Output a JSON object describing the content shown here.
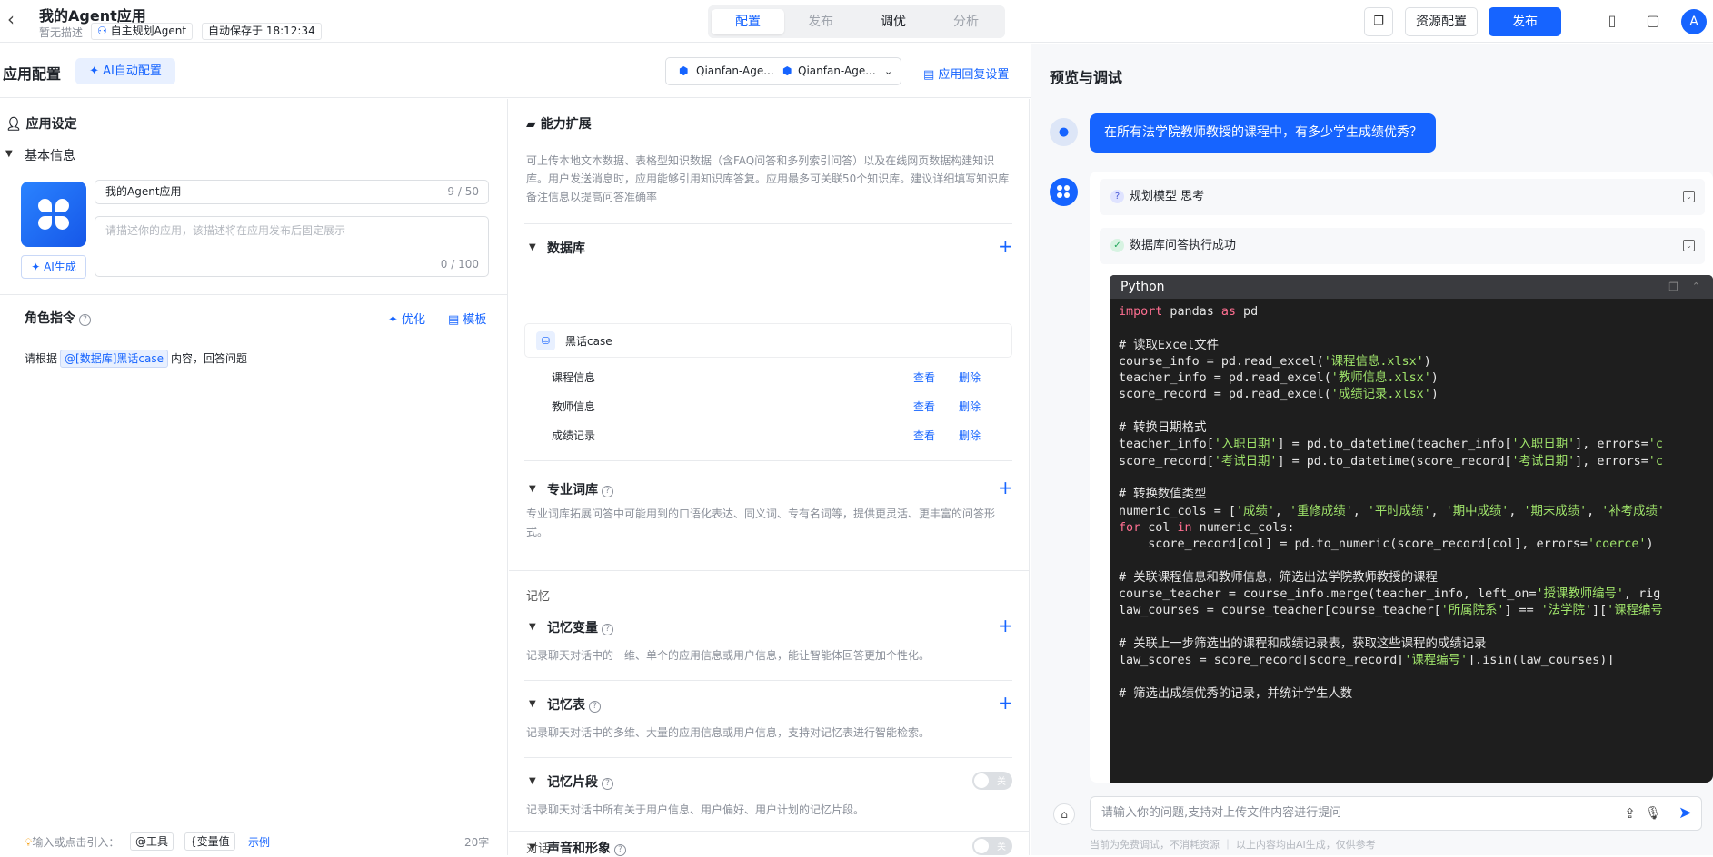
{
  "header": {
    "app_title": "我的Agent应用",
    "no_desc": "暂无描述",
    "agent_type": "自主规划Agent",
    "autosave": "自动保存于 18:12:34",
    "tabs": [
      "配置",
      "发布",
      "调优",
      "分析"
    ],
    "resource_config": "资源配置",
    "publish": "发布",
    "user_initial": "A"
  },
  "config": {
    "title": "应用配置",
    "ai_auto": "AI自动配置",
    "model_a": "Qianfan-Age...",
    "model_b": "Qianfan-Age...",
    "reply_settings": "应用回复设置"
  },
  "app_settings": {
    "title": "应用设定",
    "basic_info": "基本信息",
    "name_value": "我的Agent应用",
    "name_count": "9 / 50",
    "desc_placeholder": "请描述你的应用，该描述将在应用发布后固定展示",
    "desc_count": "0 / 100",
    "ai_gen": "AI生成",
    "role_title": "角色指令",
    "optimize": "优化",
    "template": "模板",
    "instr_prefix": "请根据",
    "instr_mention": "@[数据库]黑话case",
    "instr_suffix": "内容，回答问题",
    "foot_hint": "输入或点击引入：",
    "chip_tool": "@工具",
    "chip_var": "{变量值",
    "example": "示例",
    "char_count": "20字"
  },
  "abilities": {
    "title": "能力扩展",
    "desc": "可上传本地文本数据、表格型知识数据（含FAQ问答和多列索引问答）以及在线网页数据构建知识库。用户发送消息时，应用能够引用知识库答复。应用最多可关联50个知识库。建议详细填写知识库备注信息以提高问答准确率",
    "database": "数据库",
    "db_name": "黑话case",
    "tables": [
      "课程信息",
      "教师信息",
      "成绩记录"
    ],
    "view": "查看",
    "delete": "删除",
    "lexicon": "专业词库",
    "lexicon_desc": "专业词库拓展问答中可能用到的口语化表达、同义词、专有名词等，提供更灵活、更丰富的问答形式。",
    "memory": "记忆",
    "mem_var": "记忆变量",
    "mem_var_desc": "记录聊天对话中的一维、单个的应用信息或用户信息，能让智能体回答更加个性化。",
    "mem_table": "记忆表",
    "mem_table_desc": "记录聊天对话中的多维、大量的应用信息或用户信息，支持对记忆表进行智能检索。",
    "mem_snip": "记忆片段",
    "mem_snip_desc": "记录聊天对话中所有关于用户信息、用户偏好、用户计划的记忆片段。",
    "toggle_off": "关",
    "dialog": "对话",
    "voice": "声音和形象"
  },
  "preview": {
    "title": "预览与调试",
    "question": "在所有法学院教师教授的课程中，有多少学生成绩优秀？",
    "step1": "规划模型 思考",
    "step2": "数据库问答执行成功",
    "code_lang": "Python",
    "input_placeholder": "请输入你的问题,支持对上传文件内容进行提问",
    "disclaimer": "当前为免费调试，不消耗资源  ｜  以上内容均由AI生成，仅供参考"
  },
  "code_lines": [
    "import pandas as pd",
    "",
    "# 读取Excel文件",
    "course_info = pd.read_excel('课程信息.xlsx')",
    "teacher_info = pd.read_excel('教师信息.xlsx')",
    "score_record = pd.read_excel('成绩记录.xlsx')",
    "",
    "# 转换日期格式",
    "teacher_info['入职日期'] = pd.to_datetime(teacher_info['入职日期'], errors='c",
    "score_record['考试日期'] = pd.to_datetime(score_record['考试日期'], errors='c",
    "",
    "# 转换数值类型",
    "numeric_cols = ['成绩', '重修成绩', '平时成绩', '期中成绩', '期末成绩', '补考成绩'",
    "for col in numeric_cols:",
    "    score_record[col] = pd.to_numeric(score_record[col], errors='coerce')",
    "",
    "# 关联课程信息和教师信息，筛选出法学院教师教授的课程",
    "course_teacher = course_info.merge(teacher_info, left_on='授课教师编号', rig",
    "law_courses = course_teacher[course_teacher['所属院系'] == '法学院']['课程编号",
    "",
    "# 关联上一步筛选出的课程和成绩记录表，获取这些课程的成绩记录",
    "law_scores = score_record[score_record['课程编号'].isin(law_courses)]",
    "",
    "# 筛选出成绩优秀的记录，并统计学生人数"
  ]
}
